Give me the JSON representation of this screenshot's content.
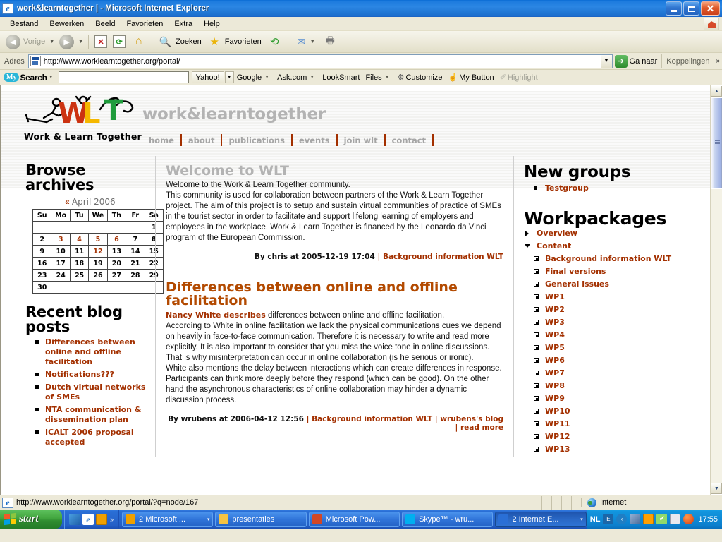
{
  "window": {
    "title": "work&learntogether |  - Microsoft Internet Explorer",
    "minimize": "_",
    "maximize": "□",
    "close": "✕"
  },
  "menubar": {
    "items": [
      "Bestand",
      "Bewerken",
      "Beeld",
      "Favorieten",
      "Extra",
      "Help"
    ]
  },
  "toolbar": {
    "back": "Vorige",
    "forward": "",
    "stop": "✕",
    "refresh": "⟳",
    "home": "⌂",
    "search": "Zoeken",
    "favorites": "Favorieten",
    "history": "⟲",
    "mail": "✉",
    "print": "🖨"
  },
  "addressbar": {
    "label": "Adres",
    "url": "http://www.worklearntogether.org/portal/",
    "go": "Ga naar",
    "links": "Koppelingen",
    "chevron": "»"
  },
  "mysearch": {
    "brand_my": "My",
    "brand_search": "Search",
    "query": "",
    "yahoo": "Yahoo!",
    "google": "Google",
    "askcom": "Ask.com",
    "looksmart": "LookSmart",
    "files": "Files",
    "customize": "Customize",
    "mybutton": "My Button",
    "highlight": "Highlight"
  },
  "site": {
    "logo_caption": "Work & Learn Together",
    "logo_letters": {
      "w": "W",
      "l": "L",
      "t": "T"
    },
    "title": "work&learntogether",
    "nav": [
      "home",
      "about",
      "publications",
      "events",
      "join wlt",
      "contact"
    ]
  },
  "left": {
    "archives_heading": "Browse archives",
    "calendar": {
      "prev": "«",
      "month": "April 2006",
      "weekdays": [
        "Su",
        "Mo",
        "Tu",
        "We",
        "Th",
        "Fr",
        "Sa"
      ],
      "weeks": [
        [
          {
            "d": "",
            "t": "empty"
          },
          {
            "d": "",
            "t": "empty"
          },
          {
            "d": "",
            "t": "empty"
          },
          {
            "d": "",
            "t": "empty"
          },
          {
            "d": "",
            "t": "empty"
          },
          {
            "d": "",
            "t": "empty"
          },
          {
            "d": "1",
            "t": "plain"
          }
        ],
        [
          {
            "d": "2",
            "t": "plain"
          },
          {
            "d": "3",
            "t": "link"
          },
          {
            "d": "4",
            "t": "link"
          },
          {
            "d": "5",
            "t": "link"
          },
          {
            "d": "6",
            "t": "link"
          },
          {
            "d": "7",
            "t": "plain"
          },
          {
            "d": "8",
            "t": "plain"
          }
        ],
        [
          {
            "d": "9",
            "t": "plain"
          },
          {
            "d": "10",
            "t": "plain"
          },
          {
            "d": "11",
            "t": "plain"
          },
          {
            "d": "12",
            "t": "today"
          },
          {
            "d": "13",
            "t": "plain"
          },
          {
            "d": "14",
            "t": "plain"
          },
          {
            "d": "15",
            "t": "plain"
          }
        ],
        [
          {
            "d": "16",
            "t": "plain"
          },
          {
            "d": "17",
            "t": "plain"
          },
          {
            "d": "18",
            "t": "plain"
          },
          {
            "d": "19",
            "t": "plain"
          },
          {
            "d": "20",
            "t": "plain"
          },
          {
            "d": "21",
            "t": "plain"
          },
          {
            "d": "22",
            "t": "plain"
          }
        ],
        [
          {
            "d": "23",
            "t": "plain"
          },
          {
            "d": "24",
            "t": "plain"
          },
          {
            "d": "25",
            "t": "plain"
          },
          {
            "d": "26",
            "t": "plain"
          },
          {
            "d": "27",
            "t": "plain"
          },
          {
            "d": "28",
            "t": "plain"
          },
          {
            "d": "29",
            "t": "plain"
          }
        ],
        [
          {
            "d": "30",
            "t": "plain"
          },
          {
            "d": "",
            "t": "empty"
          },
          {
            "d": "",
            "t": "empty"
          },
          {
            "d": "",
            "t": "empty"
          },
          {
            "d": "",
            "t": "empty"
          },
          {
            "d": "",
            "t": "empty"
          },
          {
            "d": "",
            "t": "empty"
          }
        ]
      ]
    },
    "blog_heading": "Recent blog posts",
    "blog_posts": [
      "Differences between online and offline facilitation",
      "Notifications???",
      "Dutch virtual networks of SMEs",
      "NTA communication & dissemination plan",
      "ICALT 2006 proposal accepted"
    ]
  },
  "main": {
    "articles": [
      {
        "title": "Welcome to WLT",
        "title_color": "gray",
        "lead": "",
        "body": "Welcome to the Work & Learn Together community.\nThis community is used for collaboration between partners of the Work & Learn Together project. The aim of this project is to setup and sustain virtual communities of practice of SMEs in the tourist sector in order to facilitate and support lifelong learning of employers and employees in the workplace. Work & Learn Together is financed by the Leonardo da Vinci program of the European Commission.",
        "byline": "By chris at 2005-12-19 17:04",
        "links": [
          "Background information WLT"
        ]
      },
      {
        "title": "Differences between online and offline facilitation",
        "title_color": "orange",
        "lead": "Nancy White describes",
        "body": " differences between online and offline facilitation.\nAccording to White in online facilitation we lack the physical communications cues we depend on heavily in face-to-face communication. Therefore it is necessary to write and read more explicitly. It is also important to consider that you miss the voice tone in online discussions. That is why misinterpretation can occur in online collaboration (is he serious or ironic).\nWhite also mentions the delay between interactions which can create differences in response. Participants can think more deeply before they respond (which can be good). On the other hand the asynchronous characteristics of online collaboration may hinder a dynamic discussion process.",
        "byline": "By wrubens at 2006-04-12 12:56",
        "links": [
          "Background information WLT",
          "wrubens's blog",
          "read more"
        ]
      }
    ]
  },
  "right": {
    "newgroups_heading": "New groups",
    "newgroups": [
      "Testgroup"
    ],
    "workpackages_heading": "Workpackages",
    "tree": [
      {
        "label": "Overview",
        "type": "collapsed"
      },
      {
        "label": "Content",
        "type": "expanded"
      },
      {
        "label": "Background information WLT",
        "type": "child"
      },
      {
        "label": "Final versions",
        "type": "child"
      },
      {
        "label": "General issues",
        "type": "child"
      },
      {
        "label": "WP1",
        "type": "child"
      },
      {
        "label": "WP2",
        "type": "child"
      },
      {
        "label": "WP3",
        "type": "child"
      },
      {
        "label": "WP4",
        "type": "child"
      },
      {
        "label": "WP5",
        "type": "child"
      },
      {
        "label": "WP6",
        "type": "child"
      },
      {
        "label": "WP7",
        "type": "child"
      },
      {
        "label": "WP8",
        "type": "child"
      },
      {
        "label": "WP9",
        "type": "child"
      },
      {
        "label": "WP10",
        "type": "child"
      },
      {
        "label": "WP11",
        "type": "child"
      },
      {
        "label": "WP12",
        "type": "child"
      },
      {
        "label": "WP13",
        "type": "child"
      }
    ]
  },
  "statusbar": {
    "url": "http://www.worklearntogether.org/portal/?q=node/167",
    "zone": "Internet"
  },
  "taskbar": {
    "start": "start",
    "quicklaunch_chevron": "»",
    "tasks": [
      {
        "label": "2 Microsoft ...",
        "active": false,
        "arrow": "▾",
        "color": "#f0a000"
      },
      {
        "label": "presentaties",
        "active": false,
        "arrow": "",
        "color": "#f5c343"
      },
      {
        "label": "Microsoft Pow...",
        "active": false,
        "arrow": "",
        "color": "#d24726"
      },
      {
        "label": "Skype™ - wru...",
        "active": false,
        "arrow": "",
        "color": "#00aff0"
      },
      {
        "label": "2 Internet E...",
        "active": true,
        "arrow": "▾",
        "color": "#2a6fd6"
      }
    ],
    "lang": "NL",
    "tray_chevron": "‹",
    "clock": "17:55"
  },
  "colors": {
    "accent_orange": "#a33000",
    "title_gray": "#b3b3b3",
    "xp_blue": "#2a6fd6"
  }
}
